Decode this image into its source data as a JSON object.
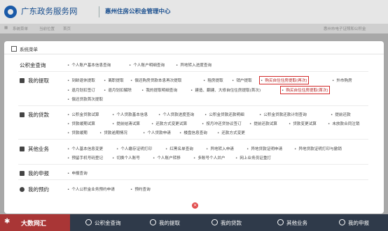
{
  "header": {
    "title": "广东政务服务网",
    "subtitle": "惠州住房公积金管理中心"
  },
  "subbar": {
    "left": [
      "系统菜单",
      "当前位置",
      "首页"
    ],
    "right": "惠州市电子证照和公积金"
  },
  "modal": {
    "title": "系统菜单",
    "sections": [
      {
        "name": "公积金查询",
        "icon": "search-icon",
        "items": [
          "个人账户基本信息查询",
          "个人账户明细查询",
          "异地转入进度查询"
        ]
      },
      {
        "name": "我的提取",
        "icon": "withdraw-icon",
        "items": [
          "到龄退休提取",
          "离职提取",
          "偿还购房贷款本息再次提取",
          "租房提取",
          "销户提取",
          "购买自住住房提取(再次)",
          "外市购房",
          "退月划扣签订",
          "退月划扣解除",
          "我的提取明细查询",
          "建造、翻建、大修自住住房提取(首次)",
          "购买自住住房提取(首次)",
          "偿还贷款首次提取"
        ]
      },
      {
        "name": "我的贷款",
        "icon": "loan-icon",
        "items": [
          "公积金贷款试算",
          "个人贷款基本信息",
          "个人贷款进度查询",
          "公积金贷款还款明细",
          "公积金贷款还款计划查询",
          "提前还款",
          "贷款缓期试算",
          "提前结清试算",
          "还款方式变更试算",
          "按月冲还贷协议签订",
          "提前还款试算",
          "贷款变更试算",
          "未放款合同注销",
          "贷款缓期",
          "贷款逾期情况",
          "个人贷款申请",
          "楼盘信息查询",
          "还款方式变更"
        ]
      },
      {
        "name": "其他业务",
        "icon": "other-icon",
        "items": [
          "个人基本信息变更",
          "个人缴存证明打印",
          "红黑名单查询",
          "异地转入申请",
          "异地贷款证明申请",
          "异地贷款证明打印与撤销",
          "预留手机号码登记",
          "切换个人账号",
          "个人账户转移",
          "多账号个人并户",
          "网上业务员证重打"
        ]
      },
      {
        "name": "我的申报",
        "icon": "declare-icon",
        "items": [
          "申报查询"
        ]
      },
      {
        "name": "我的预约",
        "icon": "clock-icon",
        "items": [
          "个人公积金业务预约申请",
          "预约查询"
        ]
      }
    ]
  },
  "bottom": {
    "logo": "大数网汇",
    "items": [
      "公积金查询",
      "我的提取",
      "我的贷款",
      "其他业务",
      "我的申报"
    ]
  },
  "colors": {
    "brand": "#1a5aa8",
    "highlight": "#d42a2a",
    "bottombar": "#2f3a4a",
    "logo_bg": "#a93636"
  }
}
